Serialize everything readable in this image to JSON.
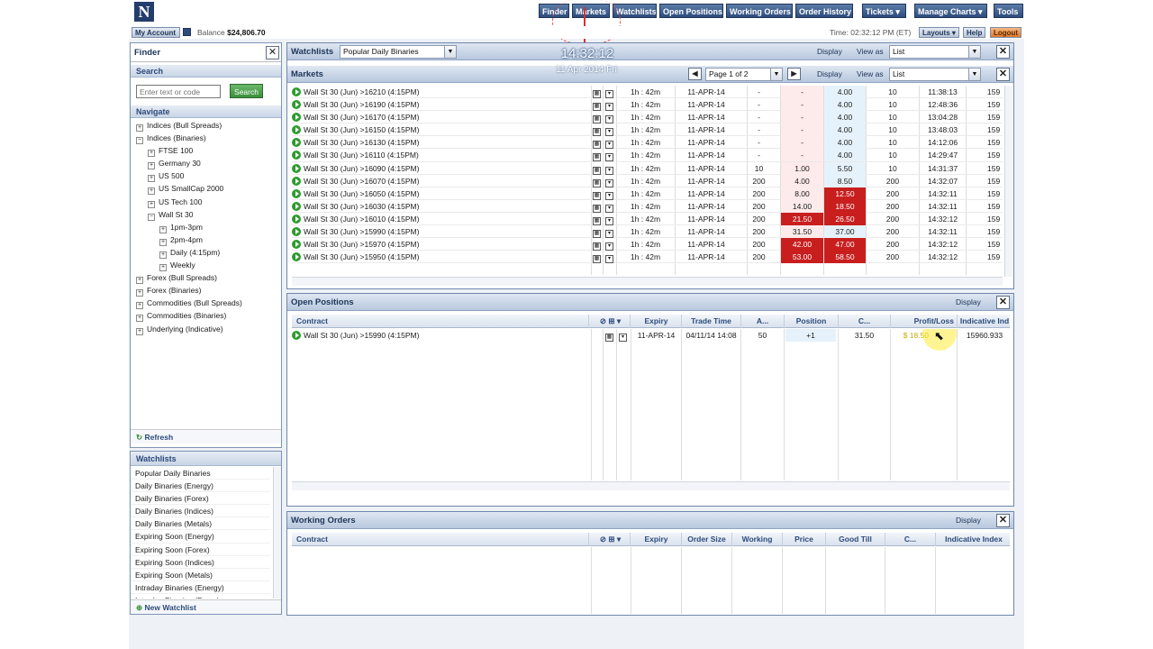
{
  "nav": {
    "finder": "Finder",
    "markets": "Markets",
    "watchlists": "Watchlists",
    "open_positions": "Open Positions",
    "working_orders": "Working Orders",
    "order_history": "Order History",
    "tickets": "Tickets",
    "manage_charts": "Manage Charts",
    "tools": "Tools"
  },
  "account": {
    "my_account": "My Account",
    "balance_label": "Balance",
    "balance": "$24,806.70",
    "time": "Time: 02:32:12 PM (ET)",
    "layouts": "Layouts",
    "help": "Help",
    "logout": "Logout"
  },
  "clock": {
    "time": "14:32:12",
    "date": "11 Apr 2014 Fri"
  },
  "finder": {
    "title": "Finder",
    "search_header": "Search",
    "search_placeholder": "Enter text or code",
    "search_button": "Search",
    "navigate_header": "Navigate",
    "tree": [
      {
        "label": "Indices (Bull Spreads)",
        "level": 0,
        "sign": "+"
      },
      {
        "label": "Indices (Binaries)",
        "level": 0,
        "sign": "−"
      },
      {
        "label": "FTSE 100",
        "level": 1,
        "sign": "+"
      },
      {
        "label": "Germany 30",
        "level": 1,
        "sign": "+"
      },
      {
        "label": "US 500",
        "level": 1,
        "sign": "+"
      },
      {
        "label": "US SmallCap 2000",
        "level": 1,
        "sign": "+"
      },
      {
        "label": "US Tech 100",
        "level": 1,
        "sign": "+"
      },
      {
        "label": "Wall St 30",
        "level": 1,
        "sign": "−"
      },
      {
        "label": "1pm-3pm",
        "level": 2,
        "sign": "+"
      },
      {
        "label": "2pm-4pm",
        "level": 2,
        "sign": "+"
      },
      {
        "label": "Daily (4:15pm)",
        "level": 2,
        "sign": "+"
      },
      {
        "label": "Weekly",
        "level": 2,
        "sign": "+"
      },
      {
        "label": "Forex (Bull Spreads)",
        "level": 0,
        "sign": "+"
      },
      {
        "label": "Forex (Binaries)",
        "level": 0,
        "sign": "+"
      },
      {
        "label": "Commodities (Bull Spreads)",
        "level": 0,
        "sign": "+"
      },
      {
        "label": "Commodities (Binaries)",
        "level": 0,
        "sign": "+"
      },
      {
        "label": "Underlying (Indicative)",
        "level": 0,
        "sign": "+"
      }
    ],
    "refresh": "Refresh"
  },
  "watchlists_panel": {
    "title": "Watchlists",
    "items": [
      "Popular Daily Binaries",
      "Daily Binaries (Energy)",
      "Daily Binaries (Forex)",
      "Daily Binaries (Indices)",
      "Daily Binaries (Metals)",
      "Expiring Soon (Energy)",
      "Expiring Soon (Forex)",
      "Expiring Soon (Indices)",
      "Expiring Soon (Metals)",
      "Intraday Binaries (Energy)",
      "Intraday Binaries (Forex)"
    ],
    "new_watchlist": "New Watchlist"
  },
  "watchlist_header": {
    "title": "Watchlists",
    "selected": "Popular Daily Binaries",
    "display": "Display",
    "view_as": "View as",
    "view_value": "List"
  },
  "markets": {
    "title": "Markets",
    "page": "Page 1 of 2",
    "display": "Display",
    "view_as": "View as",
    "view_value": "List",
    "rows": [
      {
        "name": "Wall St 30 (Jun) >16210 (4:15PM)",
        "time": "1h : 42m",
        "expiry": "11-APR-14",
        "bsize": "-",
        "bid": "-",
        "offer": "4.00",
        "osize": "10",
        "updated": "11:38:13",
        "idx": "159",
        "bid_red": false,
        "offer_red": false
      },
      {
        "name": "Wall St 30 (Jun) >16190 (4:15PM)",
        "time": "1h : 42m",
        "expiry": "11-APR-14",
        "bsize": "-",
        "bid": "-",
        "offer": "4.00",
        "osize": "10",
        "updated": "12:48:36",
        "idx": "159",
        "bid_red": false,
        "offer_red": false
      },
      {
        "name": "Wall St 30 (Jun) >16170 (4:15PM)",
        "time": "1h : 42m",
        "expiry": "11-APR-14",
        "bsize": "-",
        "bid": "-",
        "offer": "4.00",
        "osize": "10",
        "updated": "13:04:28",
        "idx": "159",
        "bid_red": false,
        "offer_red": false
      },
      {
        "name": "Wall St 30 (Jun) >16150 (4:15PM)",
        "time": "1h : 42m",
        "expiry": "11-APR-14",
        "bsize": "-",
        "bid": "-",
        "offer": "4.00",
        "osize": "10",
        "updated": "13:48:03",
        "idx": "159",
        "bid_red": false,
        "offer_red": false
      },
      {
        "name": "Wall St 30 (Jun) >16130 (4:15PM)",
        "time": "1h : 42m",
        "expiry": "11-APR-14",
        "bsize": "-",
        "bid": "-",
        "offer": "4.00",
        "osize": "10",
        "updated": "14:12:06",
        "idx": "159",
        "bid_red": false,
        "offer_red": false
      },
      {
        "name": "Wall St 30 (Jun) >16110 (4:15PM)",
        "time": "1h : 42m",
        "expiry": "11-APR-14",
        "bsize": "-",
        "bid": "-",
        "offer": "4.00",
        "osize": "10",
        "updated": "14:29:47",
        "idx": "159",
        "bid_red": false,
        "offer_red": false
      },
      {
        "name": "Wall St 30 (Jun) >16090 (4:15PM)",
        "time": "1h : 42m",
        "expiry": "11-APR-14",
        "bsize": "10",
        "bid": "1.00",
        "offer": "5.50",
        "osize": "10",
        "updated": "14:31:37",
        "idx": "159",
        "bid_red": false,
        "offer_red": false
      },
      {
        "name": "Wall St 30 (Jun) >16070 (4:15PM)",
        "time": "1h : 42m",
        "expiry": "11-APR-14",
        "bsize": "200",
        "bid": "4.00",
        "offer": "8.50",
        "osize": "200",
        "updated": "14:32:07",
        "idx": "159",
        "bid_red": false,
        "offer_red": false
      },
      {
        "name": "Wall St 30 (Jun) >16050 (4:15PM)",
        "time": "1h : 42m",
        "expiry": "11-APR-14",
        "bsize": "200",
        "bid": "8.00",
        "offer": "12.50",
        "osize": "200",
        "updated": "14:32:11",
        "idx": "159",
        "bid_red": false,
        "offer_red": true
      },
      {
        "name": "Wall St 30 (Jun) >16030 (4:15PM)",
        "time": "1h : 42m",
        "expiry": "11-APR-14",
        "bsize": "200",
        "bid": "14.00",
        "offer": "18.50",
        "osize": "200",
        "updated": "14:32:11",
        "idx": "159",
        "bid_red": false,
        "offer_red": true
      },
      {
        "name": "Wall St 30 (Jun) >16010 (4:15PM)",
        "time": "1h : 42m",
        "expiry": "11-APR-14",
        "bsize": "200",
        "bid": "21.50",
        "offer": "26.50",
        "osize": "200",
        "updated": "14:32:12",
        "idx": "159",
        "bid_red": true,
        "offer_red": true
      },
      {
        "name": "Wall St 30 (Jun) >15990 (4:15PM)",
        "time": "1h : 42m",
        "expiry": "11-APR-14",
        "bsize": "200",
        "bid": "31.50",
        "offer": "37.00",
        "osize": "200",
        "updated": "14:32:11",
        "idx": "159",
        "bid_red": false,
        "offer_red": false
      },
      {
        "name": "Wall St 30 (Jun) >15970 (4:15PM)",
        "time": "1h : 42m",
        "expiry": "11-APR-14",
        "bsize": "200",
        "bid": "42.00",
        "offer": "47.00",
        "osize": "200",
        "updated": "14:32:12",
        "idx": "159",
        "bid_red": true,
        "offer_red": true
      },
      {
        "name": "Wall St 30 (Jun) >15950 (4:15PM)",
        "time": "1h : 42m",
        "expiry": "11-APR-14",
        "bsize": "200",
        "bid": "53.00",
        "offer": "58.50",
        "osize": "200",
        "updated": "14:32:12",
        "idx": "159",
        "bid_red": true,
        "offer_red": true
      }
    ]
  },
  "open_positions": {
    "title": "Open Positions",
    "display": "Display",
    "columns": [
      "Contract",
      "Expiry",
      "Trade Time",
      "A...",
      "Position",
      "C...",
      "Profit/Loss",
      "Indicative Ind"
    ],
    "rows": [
      {
        "contract": "Wall St 30 (Jun) >15990 (4:15PM)",
        "expiry": "11-APR-14",
        "trade_time": "04/11/14 14:08",
        "a": "50",
        "position": "+1",
        "c": "31.50",
        "pl": "$ 18.50",
        "indicative": "15960.933"
      }
    ]
  },
  "working_orders": {
    "title": "Working Orders",
    "display": "Display",
    "columns": [
      "Contract",
      "Expiry",
      "Order Size",
      "Working",
      "Price",
      "Good Till",
      "C...",
      "Indicative Index"
    ]
  },
  "colors": {
    "header": "#2d4c7c",
    "red_cell": "#c81e1e",
    "profit": "#c9a800"
  }
}
